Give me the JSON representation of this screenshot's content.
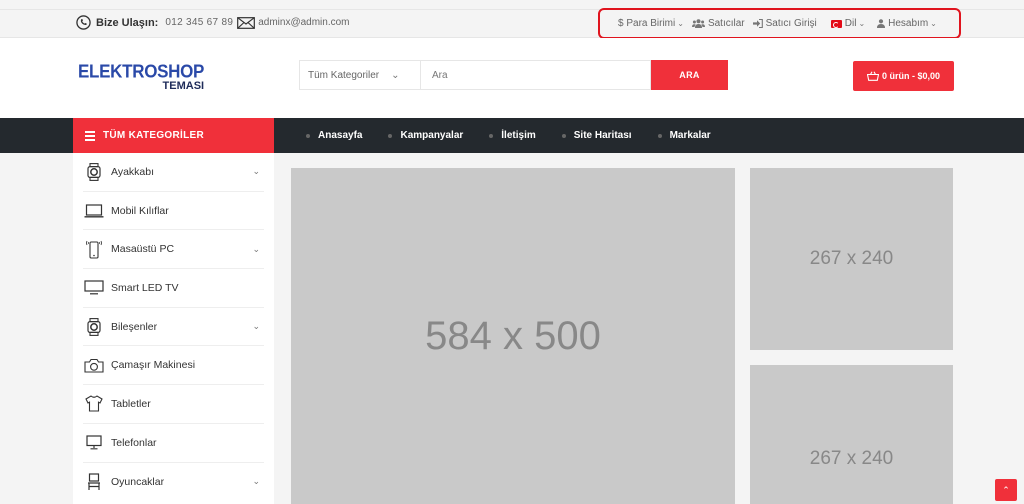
{
  "topbar": {
    "contact_label": "Bize Ulaşın:",
    "phone": "012 345 67 89",
    "email": "adminx@admin.com",
    "currency": "$ Para Birimi",
    "sellers": "Satıcılar",
    "seller_login": "Satıcı Girişi",
    "language": "Dil",
    "account": "Hesabım",
    "highlight_color": "#e0141e"
  },
  "header": {
    "logo_main": "ELEKTROSHOP",
    "logo_sub": "TEMASI",
    "category_select": "Tüm Kategoriler",
    "search_placeholder": "Ara",
    "search_button": "ARA",
    "cart": "0 ürün - $0,00"
  },
  "navbar": {
    "all_categories": "TÜM KATEGORİLER",
    "items": [
      {
        "label": "Anasayfa"
      },
      {
        "label": "Kampanyalar"
      },
      {
        "label": "İletişim"
      },
      {
        "label": "Site Haritası"
      },
      {
        "label": "Markalar"
      }
    ]
  },
  "sidebar": {
    "items": [
      {
        "label": "Ayakkabı",
        "icon": "watch-icon",
        "has_children": true
      },
      {
        "label": "Mobil Kılıflar",
        "icon": "laptop-icon",
        "has_children": false
      },
      {
        "label": "Masaüstü PC",
        "icon": "mobile-icon",
        "has_children": true
      },
      {
        "label": "Smart LED TV",
        "icon": "monitor-icon",
        "has_children": false
      },
      {
        "label": "Bileşenler",
        "icon": "watch-icon",
        "has_children": true
      },
      {
        "label": "Çamaşır Makinesi",
        "icon": "camera-icon",
        "has_children": false
      },
      {
        "label": "Tabletler",
        "icon": "tshirt-icon",
        "has_children": false
      },
      {
        "label": "Telefonlar",
        "icon": "desktop-icon",
        "has_children": false
      },
      {
        "label": "Oyuncaklar",
        "icon": "chair-icon",
        "has_children": true
      }
    ]
  },
  "banners": {
    "main": "584 x 500",
    "side_top": "267 x 240",
    "side_bottom": "267 x 240"
  },
  "colors": {
    "accent": "#f0303a",
    "nav_bg": "#24292e",
    "logo": "#2a49a8"
  }
}
